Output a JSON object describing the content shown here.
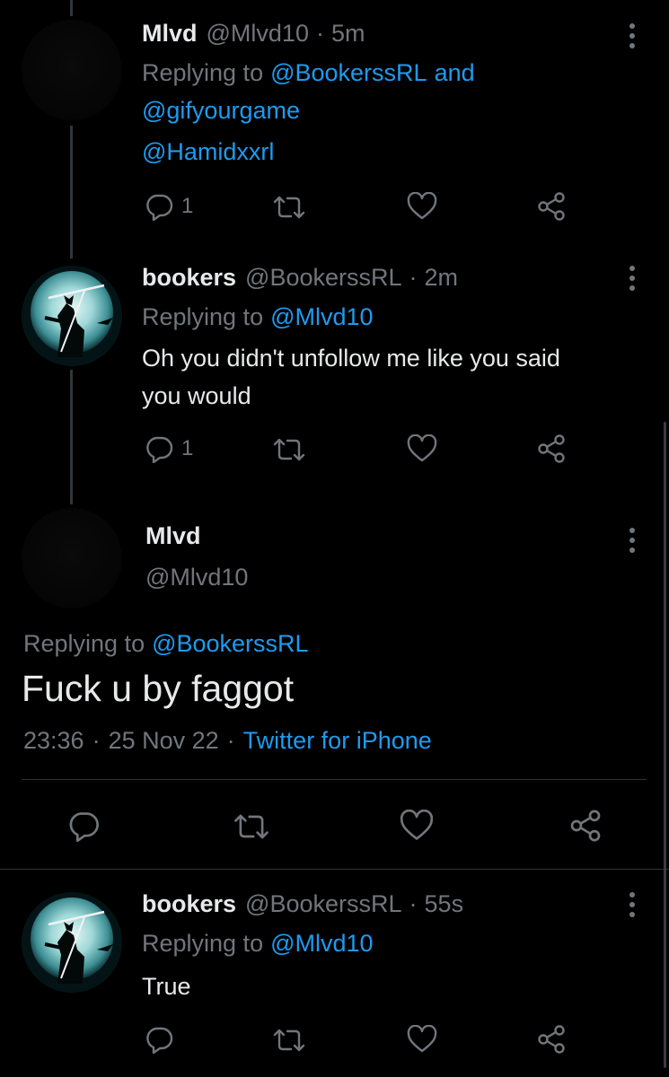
{
  "tweets": [
    {
      "name": "Mlvd",
      "handle": "@Mlvd10",
      "sep": "·",
      "time": "5m",
      "replying_prefix": "Replying to",
      "replying_line1_handle": "@BookerssRL",
      "replying_line1_and": "and",
      "replying_line2": "@gifyourgame",
      "replying_line3": "@Hamidxxrl",
      "reply_count": "1"
    },
    {
      "name": "bookers",
      "handle": "@BookerssRL",
      "sep": "·",
      "time": "2m",
      "replying_prefix": "Replying to",
      "replying_handle": "@Mlvd10",
      "text_line1": "Oh you didn't unfollow me like you said",
      "text_line2": "you would",
      "reply_count": "1"
    }
  ],
  "focused": {
    "name": "Mlvd",
    "handle": "@Mlvd10",
    "replying_prefix": "Replying to",
    "replying_handle": "@BookerssRL",
    "text": "Fuck u by faggot",
    "time": "23:36",
    "sep1": "·",
    "date": "25 Nov 22",
    "sep2": "·",
    "source": "Twitter for iPhone"
  },
  "last_reply": {
    "name": "bookers",
    "handle": "@BookerssRL",
    "sep": "·",
    "time": "55s",
    "replying_prefix": "Replying to",
    "replying_handle": "@Mlvd10",
    "text": "True"
  },
  "colors": {
    "background": "#000000",
    "text": "#e7e9ea",
    "muted": "#71767b",
    "link": "#1d9bf0"
  },
  "icons": [
    "reply-icon",
    "retweet-icon",
    "like-icon",
    "share-icon",
    "more-icon"
  ]
}
